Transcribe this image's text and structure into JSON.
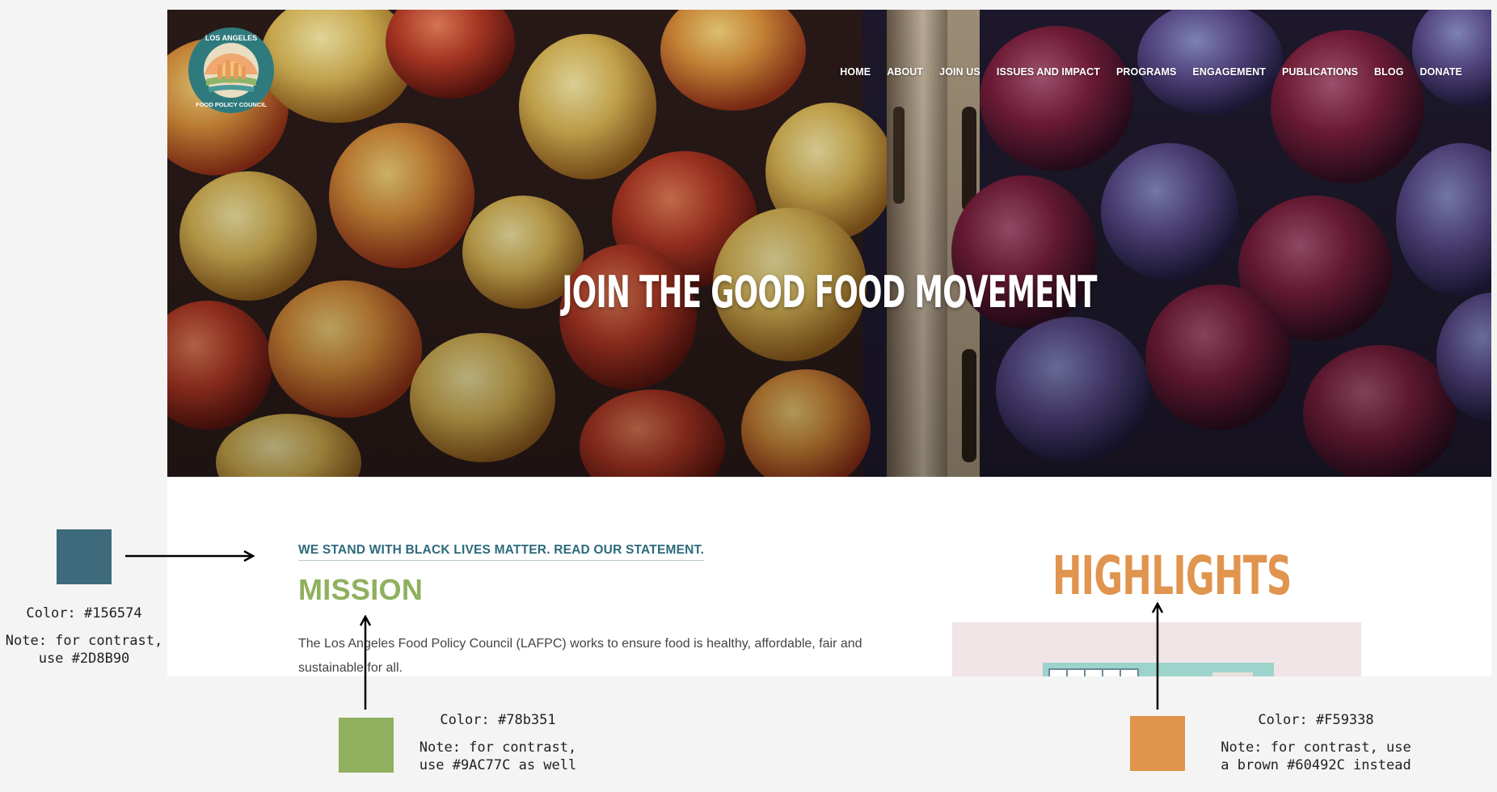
{
  "site": {
    "logo_text": "LOS ANGELES FOOD POLICY COUNCIL",
    "nav": [
      "HOME",
      "ABOUT",
      "JOIN US",
      "ISSUES AND IMPACT",
      "PROGRAMS",
      "ENGAGEMENT",
      "PUBLICATIONS",
      "BLOG",
      "DONATE"
    ],
    "hero_title": "JOIN THE GOOD FOOD MOVEMENT",
    "blm_link": "WE STAND WITH BLACK LIVES MATTER. READ OUR STATEMENT.",
    "mission_heading": "MISSION",
    "mission_text": "The Los Angeles Food Policy Council (LAFPC) works to ensure food is healthy, affordable, fair and sustainable for all.",
    "highlights_heading": "HIGHLIGHTS"
  },
  "annotations": {
    "blue": {
      "color_hex": "#156574",
      "color_label": "Color: #156574",
      "note": "Note: for contrast, use #2D8B90"
    },
    "green": {
      "color_hex": "#78b351",
      "color_label": "Color: #78b351",
      "note": "Note: for contrast, use #9AC77C as well"
    },
    "orange": {
      "color_hex": "#F59338",
      "color_label": "Color: #F59338",
      "note": "Note: for contrast, use a brown #60492C instead"
    }
  },
  "colors": {
    "page_bg": "#f4f4f4",
    "blm_text": "#2d6a7c",
    "mission_text": "#8fb05e",
    "highlights_text": "#e0944e",
    "swatch_blue": "#3e6b7b",
    "swatch_green": "#8fb05e",
    "swatch_orange": "#e0944e"
  }
}
